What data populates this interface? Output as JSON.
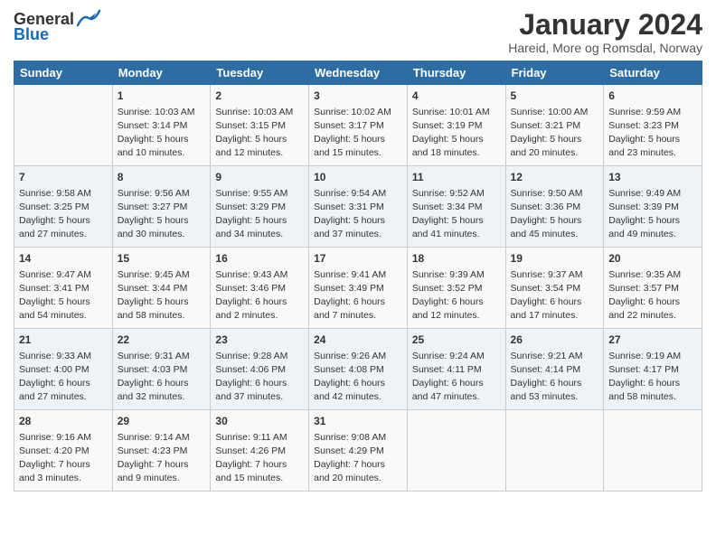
{
  "header": {
    "logo_general": "General",
    "logo_blue": "Blue",
    "month": "January 2024",
    "location": "Hareid, More og Romsdal, Norway"
  },
  "columns": [
    "Sunday",
    "Monday",
    "Tuesday",
    "Wednesday",
    "Thursday",
    "Friday",
    "Saturday"
  ],
  "weeks": [
    [
      {
        "day": "",
        "content": ""
      },
      {
        "day": "1",
        "content": "Sunrise: 10:03 AM\nSunset: 3:14 PM\nDaylight: 5 hours\nand 10 minutes."
      },
      {
        "day": "2",
        "content": "Sunrise: 10:03 AM\nSunset: 3:15 PM\nDaylight: 5 hours\nand 12 minutes."
      },
      {
        "day": "3",
        "content": "Sunrise: 10:02 AM\nSunset: 3:17 PM\nDaylight: 5 hours\nand 15 minutes."
      },
      {
        "day": "4",
        "content": "Sunrise: 10:01 AM\nSunset: 3:19 PM\nDaylight: 5 hours\nand 18 minutes."
      },
      {
        "day": "5",
        "content": "Sunrise: 10:00 AM\nSunset: 3:21 PM\nDaylight: 5 hours\nand 20 minutes."
      },
      {
        "day": "6",
        "content": "Sunrise: 9:59 AM\nSunset: 3:23 PM\nDaylight: 5 hours\nand 23 minutes."
      }
    ],
    [
      {
        "day": "7",
        "content": "Sunrise: 9:58 AM\nSunset: 3:25 PM\nDaylight: 5 hours\nand 27 minutes."
      },
      {
        "day": "8",
        "content": "Sunrise: 9:56 AM\nSunset: 3:27 PM\nDaylight: 5 hours\nand 30 minutes."
      },
      {
        "day": "9",
        "content": "Sunrise: 9:55 AM\nSunset: 3:29 PM\nDaylight: 5 hours\nand 34 minutes."
      },
      {
        "day": "10",
        "content": "Sunrise: 9:54 AM\nSunset: 3:31 PM\nDaylight: 5 hours\nand 37 minutes."
      },
      {
        "day": "11",
        "content": "Sunrise: 9:52 AM\nSunset: 3:34 PM\nDaylight: 5 hours\nand 41 minutes."
      },
      {
        "day": "12",
        "content": "Sunrise: 9:50 AM\nSunset: 3:36 PM\nDaylight: 5 hours\nand 45 minutes."
      },
      {
        "day": "13",
        "content": "Sunrise: 9:49 AM\nSunset: 3:39 PM\nDaylight: 5 hours\nand 49 minutes."
      }
    ],
    [
      {
        "day": "14",
        "content": "Sunrise: 9:47 AM\nSunset: 3:41 PM\nDaylight: 5 hours\nand 54 minutes."
      },
      {
        "day": "15",
        "content": "Sunrise: 9:45 AM\nSunset: 3:44 PM\nDaylight: 5 hours\nand 58 minutes."
      },
      {
        "day": "16",
        "content": "Sunrise: 9:43 AM\nSunset: 3:46 PM\nDaylight: 6 hours\nand 2 minutes."
      },
      {
        "day": "17",
        "content": "Sunrise: 9:41 AM\nSunset: 3:49 PM\nDaylight: 6 hours\nand 7 minutes."
      },
      {
        "day": "18",
        "content": "Sunrise: 9:39 AM\nSunset: 3:52 PM\nDaylight: 6 hours\nand 12 minutes."
      },
      {
        "day": "19",
        "content": "Sunrise: 9:37 AM\nSunset: 3:54 PM\nDaylight: 6 hours\nand 17 minutes."
      },
      {
        "day": "20",
        "content": "Sunrise: 9:35 AM\nSunset: 3:57 PM\nDaylight: 6 hours\nand 22 minutes."
      }
    ],
    [
      {
        "day": "21",
        "content": "Sunrise: 9:33 AM\nSunset: 4:00 PM\nDaylight: 6 hours\nand 27 minutes."
      },
      {
        "day": "22",
        "content": "Sunrise: 9:31 AM\nSunset: 4:03 PM\nDaylight: 6 hours\nand 32 minutes."
      },
      {
        "day": "23",
        "content": "Sunrise: 9:28 AM\nSunset: 4:06 PM\nDaylight: 6 hours\nand 37 minutes."
      },
      {
        "day": "24",
        "content": "Sunrise: 9:26 AM\nSunset: 4:08 PM\nDaylight: 6 hours\nand 42 minutes."
      },
      {
        "day": "25",
        "content": "Sunrise: 9:24 AM\nSunset: 4:11 PM\nDaylight: 6 hours\nand 47 minutes."
      },
      {
        "day": "26",
        "content": "Sunrise: 9:21 AM\nSunset: 4:14 PM\nDaylight: 6 hours\nand 53 minutes."
      },
      {
        "day": "27",
        "content": "Sunrise: 9:19 AM\nSunset: 4:17 PM\nDaylight: 6 hours\nand 58 minutes."
      }
    ],
    [
      {
        "day": "28",
        "content": "Sunrise: 9:16 AM\nSunset: 4:20 PM\nDaylight: 7 hours\nand 3 minutes."
      },
      {
        "day": "29",
        "content": "Sunrise: 9:14 AM\nSunset: 4:23 PM\nDaylight: 7 hours\nand 9 minutes."
      },
      {
        "day": "30",
        "content": "Sunrise: 9:11 AM\nSunset: 4:26 PM\nDaylight: 7 hours\nand 15 minutes."
      },
      {
        "day": "31",
        "content": "Sunrise: 9:08 AM\nSunset: 4:29 PM\nDaylight: 7 hours\nand 20 minutes."
      },
      {
        "day": "",
        "content": ""
      },
      {
        "day": "",
        "content": ""
      },
      {
        "day": "",
        "content": ""
      }
    ]
  ]
}
